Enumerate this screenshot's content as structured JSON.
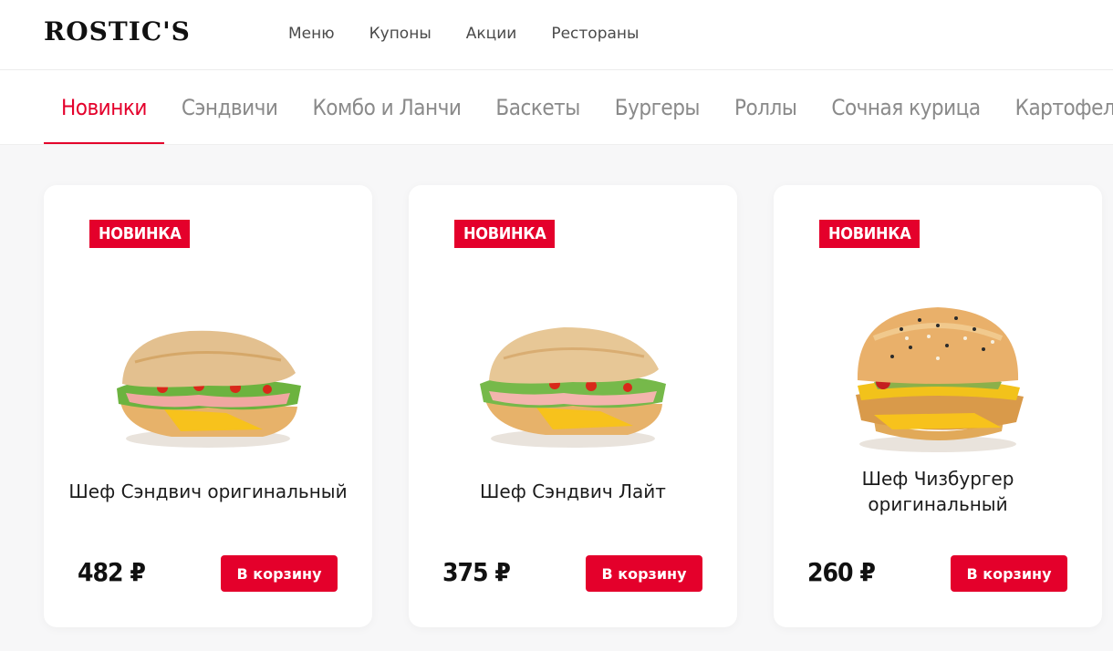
{
  "header": {
    "logo": "ROSTIC'S",
    "nav": [
      "Меню",
      "Купоны",
      "Акции",
      "Рестораны"
    ]
  },
  "categories": [
    "Новинки",
    "Сэндвичи",
    "Комбо и Ланчи",
    "Баскеты",
    "Бургеры",
    "Роллы",
    "Сочная курица",
    "Картофель и Снэки"
  ],
  "active_category": "Новинки",
  "products": [
    {
      "badge": "НОВИНКА",
      "name": "Шеф Сэндвич оригинальный",
      "price": "482 ₽",
      "button": "В корзину",
      "image": "sandwich"
    },
    {
      "badge": "НОВИНКА",
      "name": "Шеф Сэндвич Лайт",
      "price": "375 ₽",
      "button": "В корзину",
      "image": "sandwich-light"
    },
    {
      "badge": "НОВИНКА",
      "name": "Шеф Чизбургер оригинальный",
      "price": "260 ₽",
      "button": "В корзину",
      "image": "cheeseburger"
    }
  ],
  "colors": {
    "brand_red": "#e4002b",
    "background": "#f7f7f8"
  }
}
